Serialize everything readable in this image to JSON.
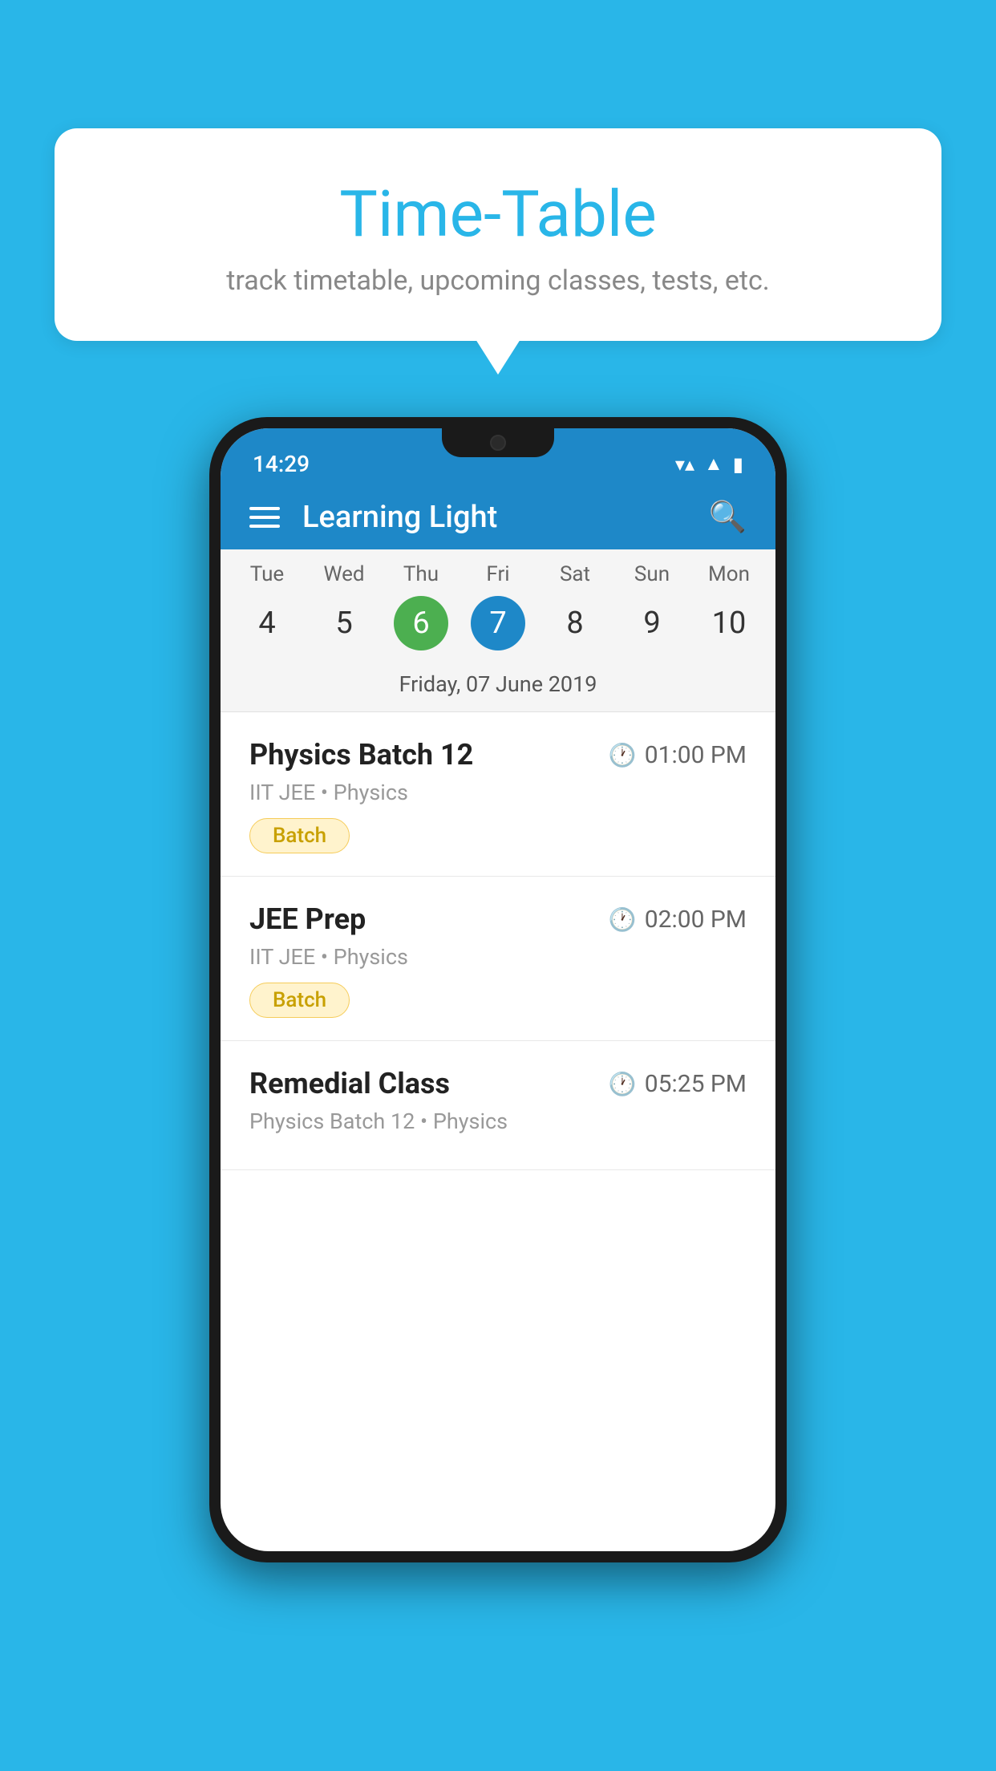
{
  "background_color": "#29b6e8",
  "bubble": {
    "title": "Time-Table",
    "subtitle": "track timetable, upcoming classes, tests, etc."
  },
  "phone": {
    "status_bar": {
      "time": "14:29",
      "icons": [
        "wifi",
        "signal",
        "battery"
      ]
    },
    "app_bar": {
      "title": "Learning Light",
      "menu_label": "Menu",
      "search_label": "Search"
    },
    "calendar": {
      "days": [
        {
          "name": "Tue",
          "number": "4",
          "state": "normal"
        },
        {
          "name": "Wed",
          "number": "5",
          "state": "normal"
        },
        {
          "name": "Thu",
          "number": "6",
          "state": "today"
        },
        {
          "name": "Fri",
          "number": "7",
          "state": "selected"
        },
        {
          "name": "Sat",
          "number": "8",
          "state": "normal"
        },
        {
          "name": "Sun",
          "number": "9",
          "state": "normal"
        },
        {
          "name": "Mon",
          "number": "10",
          "state": "normal"
        }
      ],
      "selected_date_label": "Friday, 07 June 2019"
    },
    "schedule": {
      "items": [
        {
          "title": "Physics Batch 12",
          "time": "01:00 PM",
          "subtitle": "IIT JEE • Physics",
          "badge": "Batch"
        },
        {
          "title": "JEE Prep",
          "time": "02:00 PM",
          "subtitle": "IIT JEE • Physics",
          "badge": "Batch"
        },
        {
          "title": "Remedial Class",
          "time": "05:25 PM",
          "subtitle": "Physics Batch 12 • Physics",
          "badge": null
        }
      ]
    }
  }
}
